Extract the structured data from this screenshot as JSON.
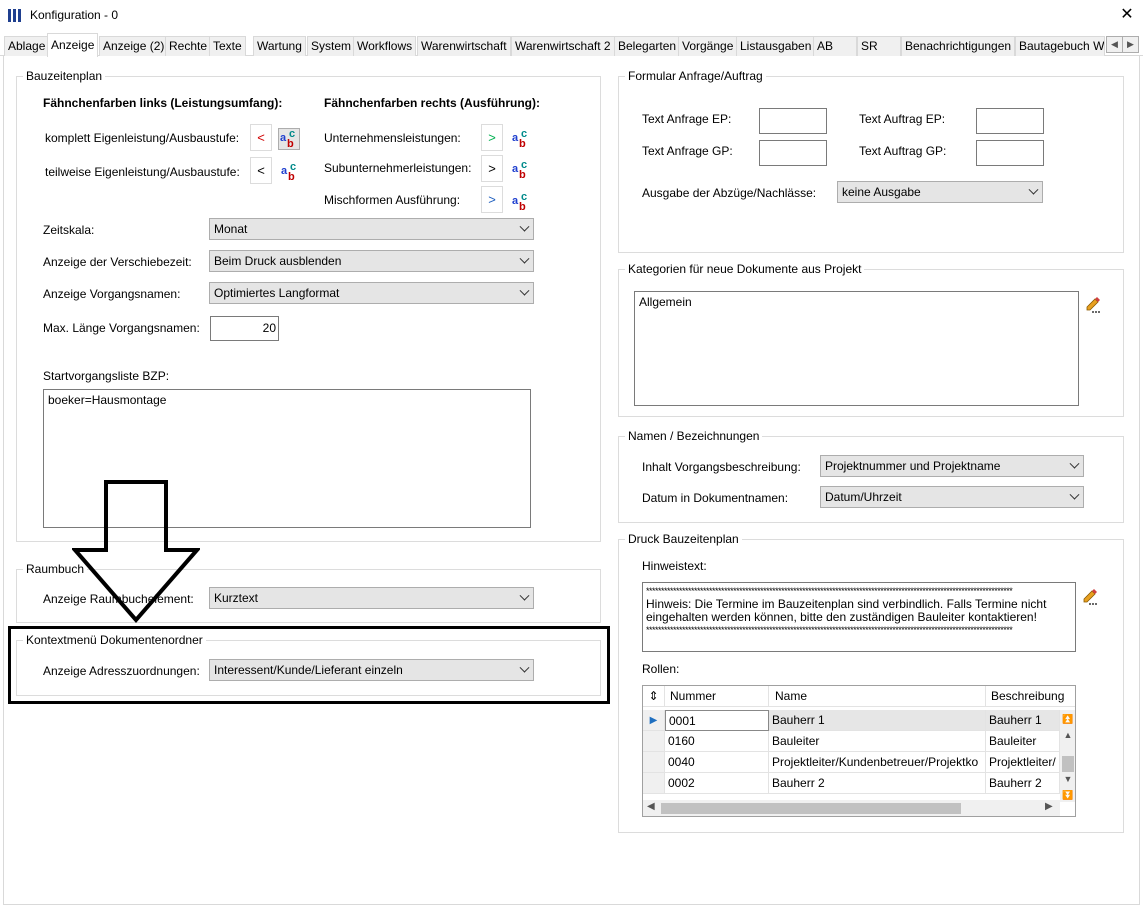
{
  "window": {
    "title": "Konfiguration - 0"
  },
  "tabs": [
    {
      "label": "Ablage",
      "active": false
    },
    {
      "label": "Anzeige",
      "active": true
    },
    {
      "label": "Anzeige (2)",
      "active": false
    },
    {
      "label": "Rechte",
      "active": false
    },
    {
      "label": "Texte",
      "active": false
    },
    {
      "label": "Wartung",
      "active": false
    },
    {
      "label": "System",
      "active": false
    },
    {
      "label": "Workflows",
      "active": false
    },
    {
      "label": "Warenwirtschaft",
      "active": false
    },
    {
      "label": "Warenwirtschaft 2",
      "active": false
    },
    {
      "label": "Belegarten",
      "active": false
    },
    {
      "label": "Vorgänge",
      "active": false
    },
    {
      "label": "Listausgaben",
      "active": false
    },
    {
      "label": "AB",
      "active": false
    },
    {
      "label": "SR",
      "active": false
    },
    {
      "label": "Benachrichtigungen",
      "active": false
    },
    {
      "label": "Bautagebuch W",
      "active": false
    }
  ],
  "bauzeitenplan": {
    "title": "Bauzeitenplan",
    "left_header": "Fähnchenfarben links (Leistungsumfang):",
    "right_header": "Fähnchenfarben rechts (Ausführung):",
    "left_rows": [
      {
        "label": "komplett Eigenleistung/Ausbaustufe:",
        "symbol": "<",
        "color": "#d00000"
      },
      {
        "label": "teilweise Eigenleistung/Ausbaustufe:",
        "symbol": "<",
        "color": "#000000"
      }
    ],
    "right_rows": [
      {
        "label": "Unternehmensleistungen:",
        "symbol": ">",
        "color": "#00b050"
      },
      {
        "label": "Subunternehmerleistungen:",
        "symbol": ">",
        "color": "#000000"
      },
      {
        "label": "Mischformen Ausführung:",
        "symbol": ">",
        "color": "#1f5fbf"
      }
    ],
    "zeitskala_label": "Zeitskala:",
    "zeitskala_value": "Monat",
    "verschiebezeit_label": "Anzeige der Verschiebezeit:",
    "verschiebezeit_value": "Beim Druck ausblenden",
    "vorgangsnamen_label": "Anzeige Vorgangsnamen:",
    "vorgangsnamen_value": "Optimiertes Langformat",
    "maxlaenge_label": "Max. Länge Vorgangsnamen:",
    "maxlaenge_value": "20",
    "startliste_label": "Startvorgangsliste BZP:",
    "startliste_value": "boeker=Hausmontage"
  },
  "raumbuch": {
    "title": "Raumbuch",
    "element_label": "Anzeige Raumbuchelement:",
    "element_value": "Kurztext"
  },
  "kontextmenue": {
    "title": "Kontextmenü Dokumentenordner",
    "adress_label": "Anzeige Adresszuordnungen:",
    "adress_value": "Interessent/Kunde/Lieferant einzeln"
  },
  "formular": {
    "title": "Formular Anfrage/Auftrag",
    "text_anfrage_ep": "Text Anfrage EP:",
    "text_auftrag_ep": "Text Auftrag EP:",
    "text_anfrage_gp": "Text Anfrage GP:",
    "text_auftrag_gp": "Text Auftrag GP:",
    "ausgabe_label": "Ausgabe der Abzüge/Nachlässe:",
    "ausgabe_value": "keine Ausgabe"
  },
  "kategorien": {
    "title": "Kategorien für neue Dokumente aus Projekt",
    "value": "Allgemein"
  },
  "namen": {
    "title": "Namen / Bezeichnungen",
    "inhalt_label": "Inhalt Vorgangsbeschreibung:",
    "inhalt_value": "Projektnummer und Projektname",
    "datum_label": "Datum in Dokumentnamen:",
    "datum_value": "Datum/Uhrzeit"
  },
  "druck": {
    "title": "Druck Bauzeitenplan",
    "hinweis_label": "Hinweistext:",
    "hinweis_stars": "**************************************************************************************************************************",
    "hinweis_line1": "Hinweis: Die Termine im Bauzeitenplan sind verbindlich. Falls Termine nicht",
    "hinweis_line2": "eingehalten werden können, bitte den zuständigen Bauleiter kontaktieren!",
    "rollen_label": "Rollen:",
    "columns": [
      "Nummer",
      "Name",
      "Beschreibung"
    ],
    "rows": [
      {
        "nummer": "0001",
        "name": "Bauherr 1",
        "beschreibung": "Bauherr 1"
      },
      {
        "nummer": "0160",
        "name": "Bauleiter",
        "beschreibung": "Bauleiter"
      },
      {
        "nummer": "0040",
        "name": "Projektleiter/Kundenbetreuer/Projektko",
        "beschreibung": "Projektleiter/"
      },
      {
        "nummer": "0002",
        "name": "Bauherr 2",
        "beschreibung": "Bauherr 2"
      }
    ]
  }
}
